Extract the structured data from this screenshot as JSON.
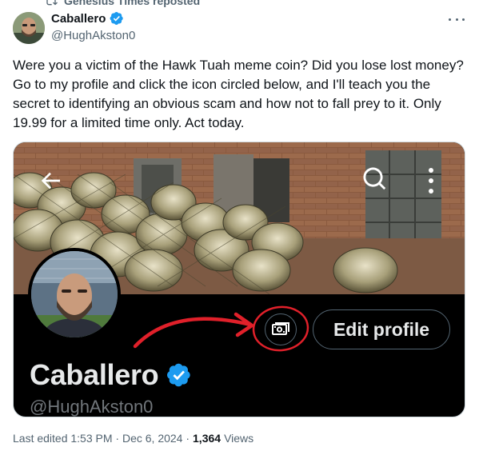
{
  "repost": {
    "label": "Genesius Times reposted",
    "icon": "repost-icon"
  },
  "author": {
    "name": "Caballero",
    "handle": "@HughAkston0",
    "verified_color": "#1d9bf0"
  },
  "tweet": {
    "text": "Were you a victim of the Hawk Tuah meme coin? Did you lose lost money? Go to my profile and click the icon circled below, and I'll teach you the secret to identifying an obvious scam and how not to fall prey to it. Only 19.99 for a limited time only. Act today."
  },
  "media": {
    "profile": {
      "name": "Caballero",
      "handle": "@HughAkston0",
      "edit_button_label": "Edit profile",
      "icons": [
        "back-arrow-icon",
        "search-icon",
        "more-vertical-icon",
        "money-icon"
      ],
      "annotation_color": "#e0202a"
    }
  },
  "meta": {
    "edited_label": "Last edited 1:53 PM · Dec 6, 2024 ·",
    "views_count": "1,364",
    "views_label": "Views"
  },
  "colors": {
    "accent": "#1d9bf0",
    "muted": "#536471",
    "text": "#0f1419"
  }
}
